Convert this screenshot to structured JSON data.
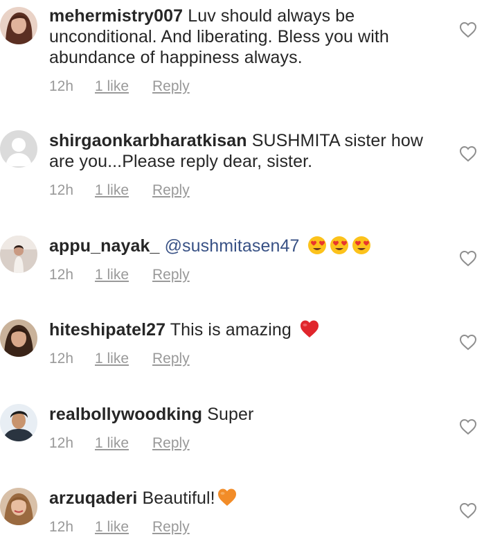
{
  "comments": [
    {
      "username": "mehermistry007",
      "text": "Luv should always be unconditional.  And liberating. Bless you with abundance of happiness always.",
      "mention": "",
      "emojis": [],
      "time": "12h",
      "likes": "1 like",
      "reply": "Reply",
      "avatar_color": "#7a4a3a"
    },
    {
      "username": "shirgaonkarbharatkisan",
      "text": "SUSHMITA sister how are you...Please reply dear, sister.",
      "mention": "",
      "emojis": [],
      "time": "12h",
      "likes": "1 like",
      "reply": "Reply",
      "avatar_color": "#dbdbdb"
    },
    {
      "username": "appu_nayak_",
      "text": "",
      "mention": "@sushmitasen47",
      "emojis": [
        "heart-eyes-emoji",
        "heart-eyes-emoji",
        "heart-eyes-emoji"
      ],
      "time": "12h",
      "likes": "1 like",
      "reply": "Reply",
      "avatar_color": "#b89a8a"
    },
    {
      "username": "hiteshipatel27",
      "text": "This is amazing",
      "mention": "",
      "emojis": [
        "red-heart-emoji"
      ],
      "time": "12h",
      "likes": "1 like",
      "reply": "Reply",
      "avatar_color": "#8a6a50"
    },
    {
      "username": "realbollywoodking",
      "text": "Super",
      "mention": "",
      "emojis": [],
      "time": "12h",
      "likes": "1 like",
      "reply": "Reply",
      "avatar_color": "#6a7a8a"
    },
    {
      "username": "arzuqaderi",
      "text": "Beautiful!",
      "mention": "",
      "emojis": [
        "orange-heart-emoji"
      ],
      "time": "12h",
      "likes": "1 like",
      "reply": "Reply",
      "avatar_color": "#c49a70"
    }
  ],
  "colors": {
    "text": "#262626",
    "meta": "#999999",
    "mention": "#385185",
    "heart_outline": "#8e8e8e"
  },
  "icons": {
    "like": "heart-outline-icon"
  }
}
